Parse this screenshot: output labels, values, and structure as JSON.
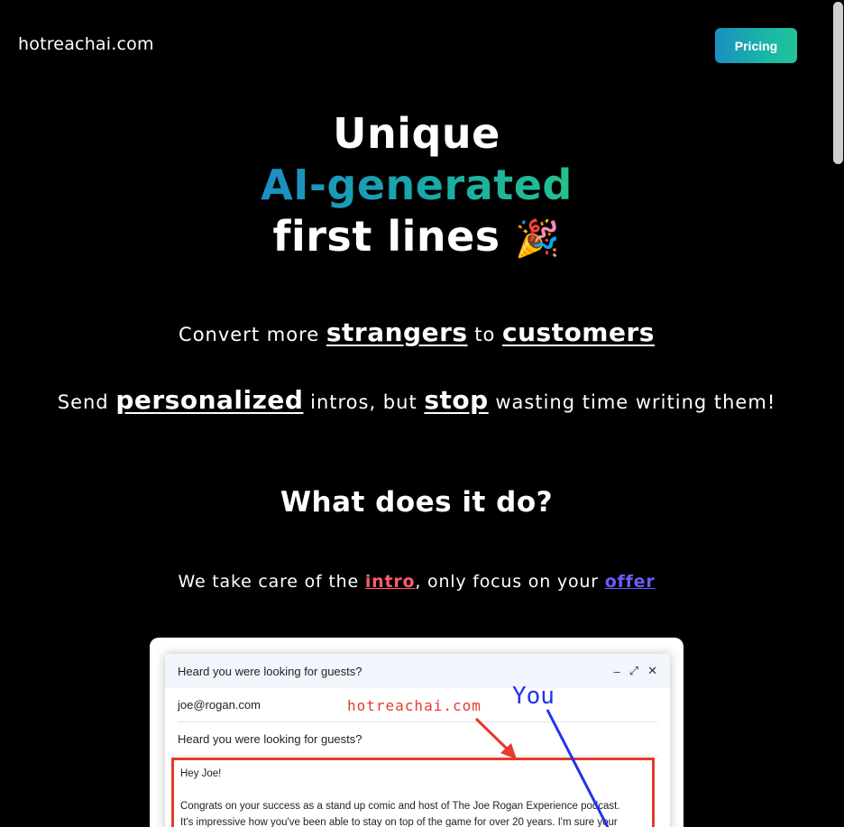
{
  "header": {
    "logo": "hotreachai.com",
    "pricing_label": "Pricing"
  },
  "hero": {
    "line1": "Unique",
    "line2": "AI-generated",
    "line3": "first lines",
    "emoji": "🎉"
  },
  "tagline1": {
    "a": "Convert more ",
    "b": "strangers",
    "c": " to ",
    "d": "customers"
  },
  "tagline2": {
    "a": "Send ",
    "b": "personalized",
    "c": " intros, but ",
    "d": "stop",
    "e": " wasting time writing them!"
  },
  "section": {
    "title": "What does it do?",
    "sub_a": "We take care of the ",
    "sub_intro": "intro",
    "sub_b": ", only focus on your ",
    "sub_offer": "offer"
  },
  "email": {
    "header_title": "Heard you were looking for guests?",
    "minimize": "–",
    "expand": "⤢",
    "close": "✕",
    "to": "joe@rogan.com",
    "subject": "Heard you were looking for guests?",
    "greeting": "Hey Joe!",
    "body_line1": "Congrats on your success as a stand up comic and host of The Joe Rogan Experience podcast.",
    "body_line2": "It's impressive how you've been able to stay on top of the game for over 20 years. I'm sure your",
    "annotation_domain": "hotreachai.com",
    "annotation_you": "You"
  },
  "colors": {
    "accent_start": "#1c8ec4",
    "accent_end": "#26c08f",
    "intro": "#ff5a6e",
    "offer": "#6b5bff",
    "annotation_red": "#e53a2c",
    "annotation_blue": "#2233ee"
  }
}
